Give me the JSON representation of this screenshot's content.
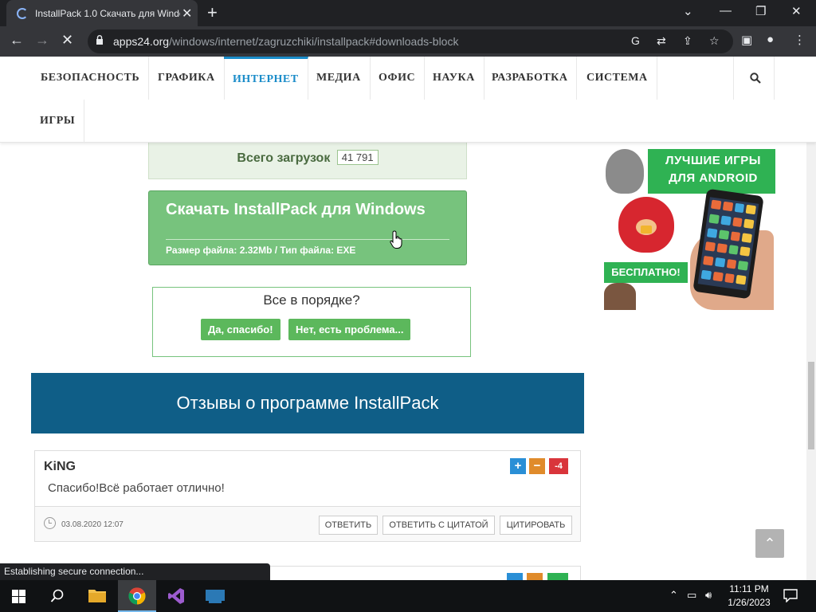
{
  "browser": {
    "tab_title": "InstallPack 1.0 Скачать для Windows",
    "new_tab": "+",
    "url_host": "apps24.org",
    "url_path": "/windows/internet/zagruzchiki/installpack#downloads-block",
    "status": "Establishing secure connection..."
  },
  "nav": {
    "items": [
      "БЕЗОПАСНОСТЬ",
      "ГРАФИКА",
      "ИНТЕРНЕТ",
      "МЕДИА",
      "ОФИС",
      "НАУКА",
      "РАЗРАБОТКА",
      "СИСТЕМА",
      "ИГРЫ"
    ],
    "active": "ИНТЕРНЕТ"
  },
  "download": {
    "count_label": "Всего загрузок",
    "count_value": "41 791",
    "button_main": "Скачать InstallPack для Windows",
    "button_sub": "Размер файла: 2.32Mb / Тип файла: EXE"
  },
  "feedback": {
    "question": "Все в порядке?",
    "yes": "Да, спасибо!",
    "no": "Нет, есть проблема..."
  },
  "reviews": {
    "header": "Отзывы о программе InstallPack",
    "comments": [
      {
        "author": "KiNG",
        "text": "Спасибо!Всё работает отлично!",
        "rating": "-4",
        "date": "03.08.2020 12:07",
        "reply": "ОТВЕТИТЬ",
        "reply_quote": "ОТВЕТИТЬ С ЦИТАТОЙ",
        "quote": "ЦИТИРОВАТЬ"
      }
    ]
  },
  "ad": {
    "title": "ЛУЧШИЕ ИГРЫ ДЛЯ ANDROID",
    "badge": "БЕСПЛАТНО!"
  },
  "taskbar": {
    "time": "11:11 PM",
    "date": "1/26/2023"
  },
  "colors": {
    "accent": "#1a8cc9",
    "download_green": "#77c37d",
    "review_header": "#0f5e87",
    "plus": "#2a8fd6",
    "minus": "#e08b2b",
    "rating_negative": "#d9353b"
  }
}
